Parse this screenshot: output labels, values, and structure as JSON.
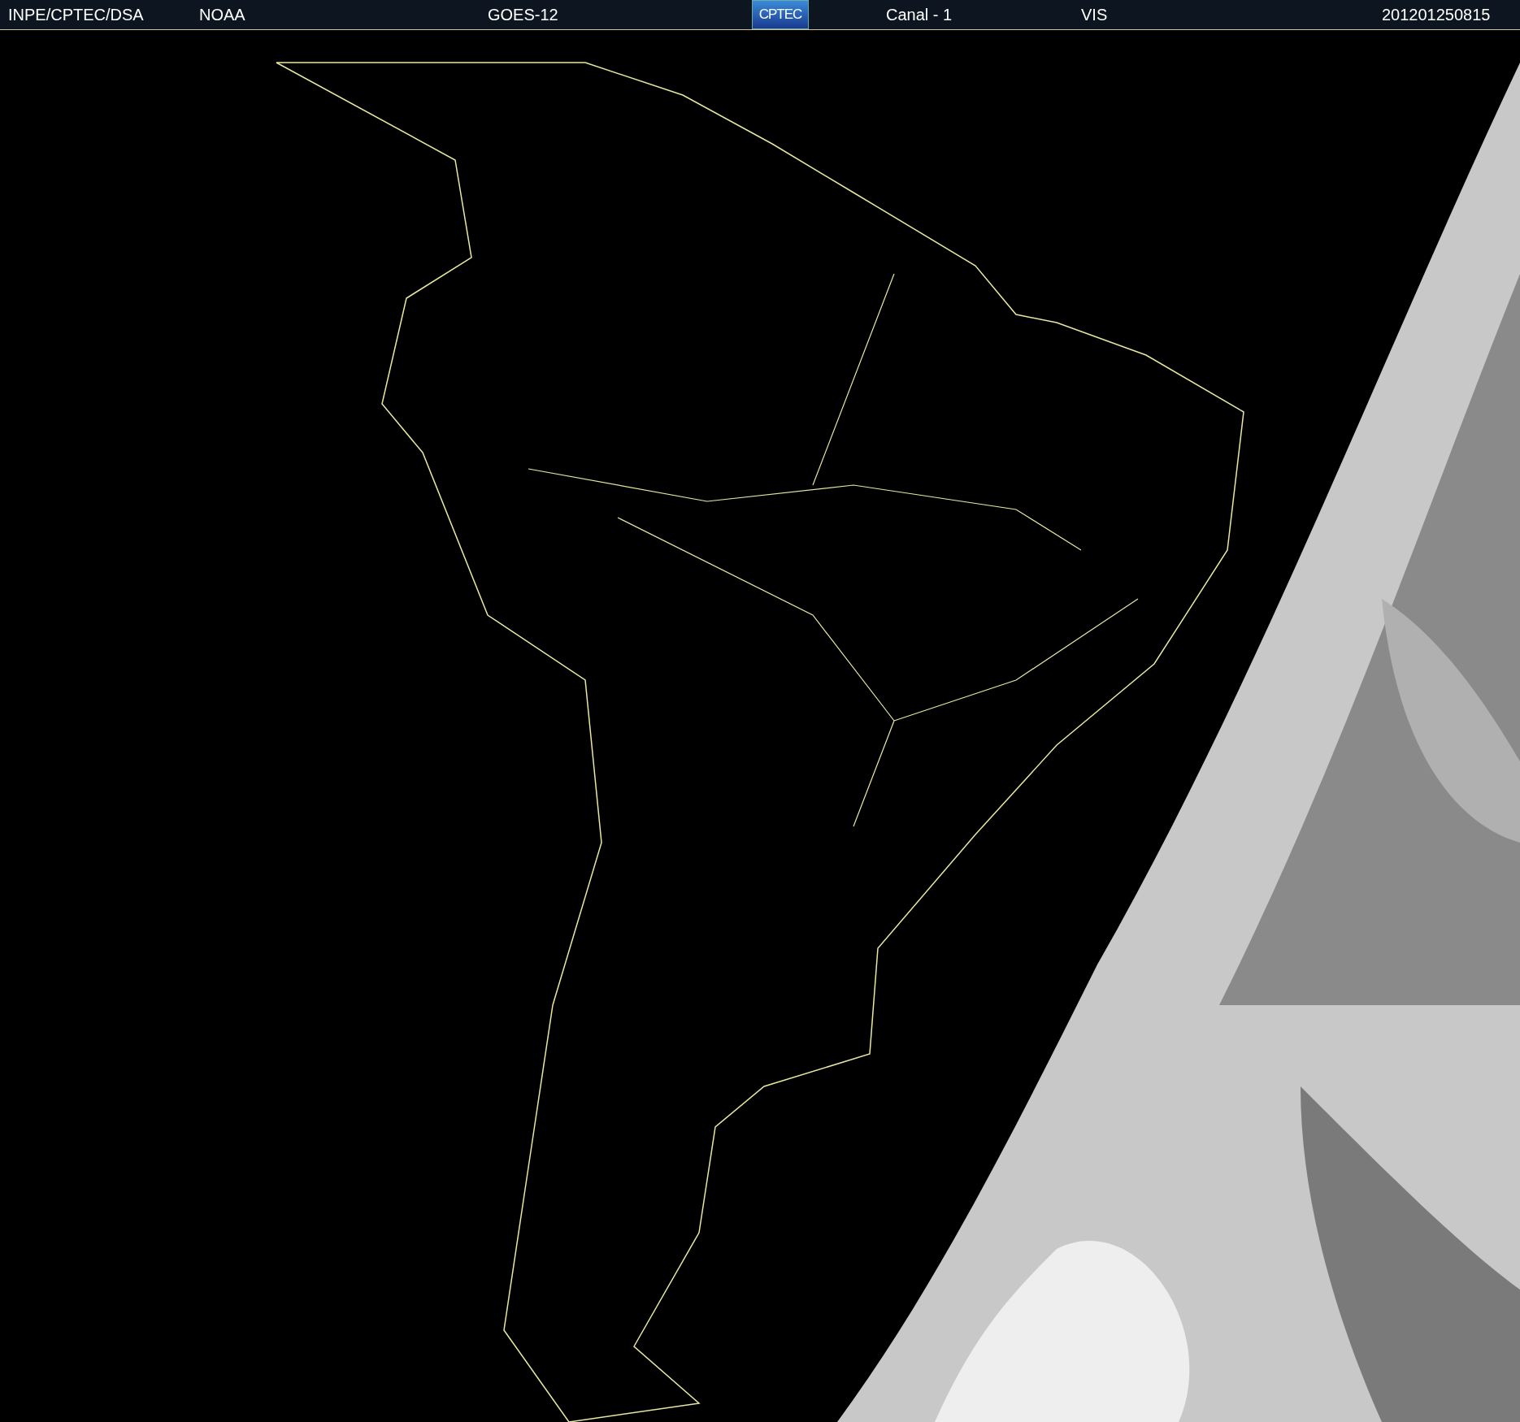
{
  "header": {
    "labels": [
      {
        "text": "INPE/CPTEC/DSA"
      },
      {
        "text": "NOAA"
      },
      {
        "text": "GOES-12"
      },
      {
        "text": "CPTEC",
        "kind": "logo"
      },
      {
        "text": "Canal - 1"
      },
      {
        "text": "VIS"
      },
      {
        "text": "201201250815"
      }
    ]
  }
}
